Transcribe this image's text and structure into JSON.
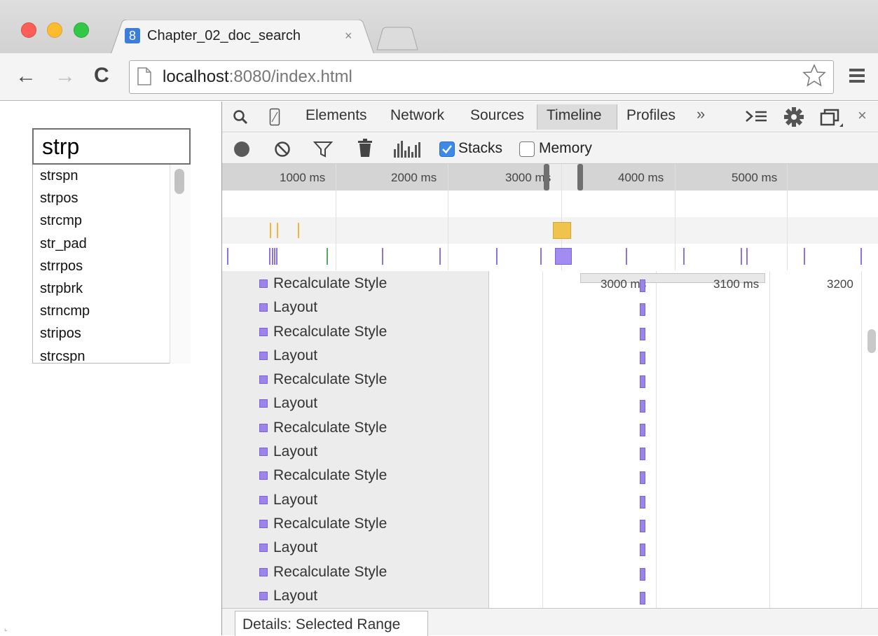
{
  "browser": {
    "tab_title": "Chapter_02_doc_search",
    "tab_favicon": "8",
    "tab_close": "×",
    "url_host": "localhost",
    "url_path": ":8080/index.html",
    "back_icon": "←",
    "forward_icon": "→",
    "reload_icon": "C"
  },
  "page": {
    "search_value": "strp",
    "suggestions": [
      "strspn",
      "strpos",
      "strcmp",
      "str_pad",
      "strrpos",
      "strpbrk",
      "strncmp",
      "stripos",
      "strcspn"
    ]
  },
  "devtools": {
    "tabs": [
      "Elements",
      "Network",
      "Sources",
      "Timeline",
      "Profiles"
    ],
    "active_tab": "Timeline",
    "more": "»",
    "close": "×",
    "stacks_label": "Stacks",
    "stacks_checked": true,
    "memory_label": "Memory",
    "memory_checked": false,
    "overview_labels": [
      "1000 ms",
      "2000 ms",
      "3000 ms",
      "4000 ms",
      "5000 ms"
    ],
    "detail_labels": [
      "3000 ms",
      "3100 ms",
      "3200"
    ],
    "records": [
      "Recalculate Style",
      "Layout",
      "Recalculate Style",
      "Layout",
      "Recalculate Style",
      "Layout",
      "Recalculate Style",
      "Layout",
      "Recalculate Style",
      "Layout",
      "Recalculate Style",
      "Layout",
      "Recalculate Style",
      "Layout"
    ],
    "details_label": "Details: Selected Range"
  },
  "colors": {
    "rendering": "#9c84ea",
    "scripting": "#f0c44c",
    "painting": "#5aa85a",
    "checkbox_accent": "#3d8ae8"
  }
}
